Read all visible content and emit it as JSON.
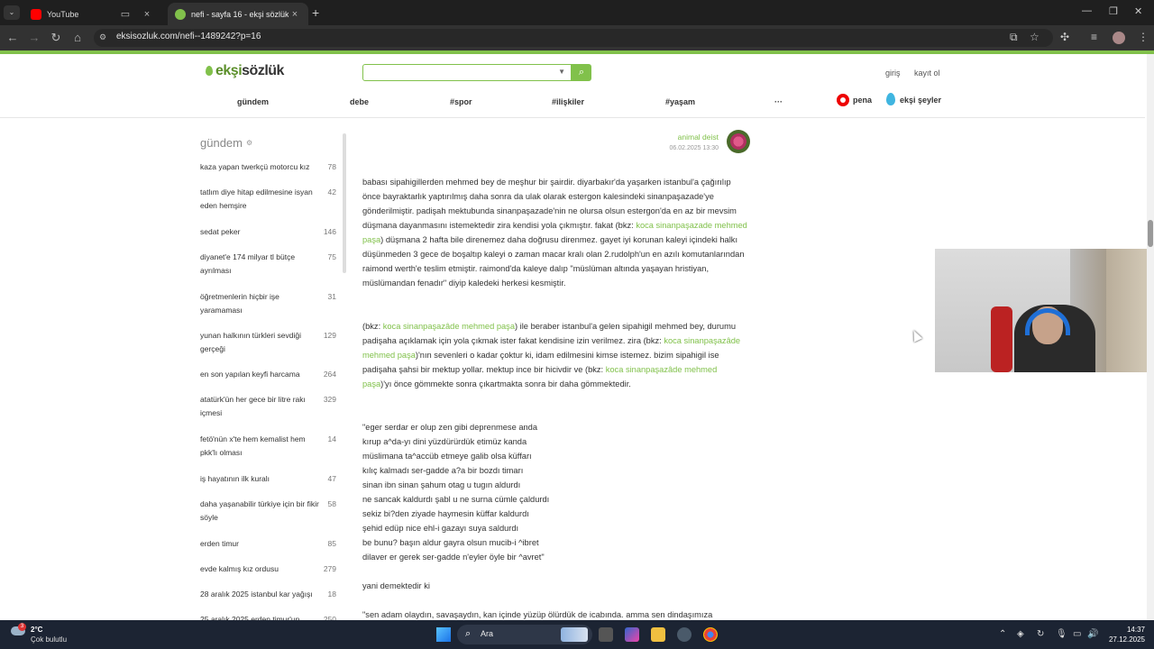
{
  "browser": {
    "tabs": [
      {
        "title": "YouTube",
        "favicon_color": "#ff0000"
      },
      {
        "title": "nefi - sayfa 16 - ekşi sözlük",
        "favicon_color": "#81c14b"
      }
    ],
    "url": "eksisozluk.com/nefi--1489242?p=16"
  },
  "site": {
    "logo_left": "ekşi",
    "logo_right": "sözlük",
    "search_placeholder": "",
    "login": "giriş",
    "register": "kayıt ol",
    "nav": [
      "gündem",
      "debe",
      "#spor",
      "#ilişkiler",
      "#yaşam",
      "···"
    ],
    "pena": "pena",
    "seyler": "ekşi şeyler",
    "accent_color": "#81c14b"
  },
  "sidebar": {
    "title": "gündem",
    "items": [
      {
        "title": "kaza yapan twerkçü motorcu kız",
        "count": "78"
      },
      {
        "title": "tatlım diye hitap edilmesine isyan eden hemşire",
        "count": "42"
      },
      {
        "title": "sedat peker",
        "count": "146"
      },
      {
        "title": "diyanet'e 174 milyar tl bütçe ayrılması",
        "count": "75"
      },
      {
        "title": "öğretmenlerin hiçbir işe yaramaması",
        "count": "31"
      },
      {
        "title": "yunan halkının türkleri sevdiği gerçeği",
        "count": "129"
      },
      {
        "title": "en son yapılan keyfi harcama",
        "count": "264"
      },
      {
        "title": "atatürk'ün her gece bir litre rakı içmesi",
        "count": "329"
      },
      {
        "title": "fetö'nün x'te hem kemalist hem pkk'lı olması",
        "count": "14"
      },
      {
        "title": "iş hayatının ilk kuralı",
        "count": "47"
      },
      {
        "title": "daha yaşanabilir türkiye için bir fikir söyle",
        "count": "58"
      },
      {
        "title": "erden timur",
        "count": "85"
      },
      {
        "title": "evde kalmış kız ordusu",
        "count": "279"
      },
      {
        "title": "28 aralık 2025 istanbul kar yağışı",
        "count": "18"
      },
      {
        "title": "25 aralık 2025 erden timur'un",
        "count": "250"
      }
    ]
  },
  "entry": {
    "author": "animal deist",
    "date": "06.02.2025 13:30",
    "p1_a": "babası sipahigillerden mehmed bey de meşhur bir şairdir. diyarbakır'da yaşarken istanbul'a çağırılıp önce bayraktarlık yaptırılmış daha sonra da ulak olarak estergon kalesindeki sinanpaşazade'ye gönderilmiştir. padişah mektubunda sinanpaşazade'nin ne olursa olsun estergon'da en az bir mevsim düşmana dayanmasını istemektedir zira kendisi yola çıkmıştır. fakat (bkz: ",
    "p1_link": "koca sinanpaşazade mehmed paşa",
    "p1_b": ") düşmana 2 hafta bile direnemez daha doğrusu direnmez. gayet iyi korunan kaleyi içindeki halkı düşünmeden 3 gece de boşaltıp kaleyi o zaman macar kralı olan 2.rudolph'un en azılı komutanlarından raimond werth'e teslim etmiştir. raimond'da kaleye dalıp \"müslüman altında yaşayan hristiyan, müslümandan fenadır\" diyip kaledeki herkesi kesmiştir.",
    "p2_a": "(bkz: ",
    "p2_link1": "koca sinanpaşazâde mehmed paşa",
    "p2_b": ") ile beraber istanbul'a gelen sipahigil mehmed bey, durumu padişaha açıklamak için yola çıkmak ister fakat kendisine izin verilmez. zira (bkz: ",
    "p2_link2": "koca sinanpaşazâde mehmed paşa",
    "p2_c": ")'nın sevenleri o kadar çoktur ki, idam edilmesini kimse istemez. bizim sipahigil ise padişaha şahsi bir mektup yollar. mektup ince bir hicivdir ve (bkz: ",
    "p2_link3": "koca sinanpaşazâde mehmed paşa",
    "p2_d": ")'yı önce gömmekte sonra çıkartmakta sonra bir daha gömmektedir.",
    "poem": [
      "\"eger serdar er olup zen gibi deprenmese anda",
      "kırup a^da-yı dini yüzdürürdük etimüz kanda",
      "müslimana ta^accüb etmeye galib olsa küffarı",
      "kılıç kalmadı ser-gadde a?a bir bozdı timarı",
      "sinan ibn sinan şahum otag u tugın aldurdı",
      "ne sancak kaldurdı şabl u ne surna cümle çaldurdı",
      "sekiz bi?den ziyade haymesin küffar kaldurdı",
      "şehid edüp nice ehl-i gazayı suya saldurdı",
      "be bunu? başın aldur gayra olsun mucib-i ^ibret",
      "dilaver er gerek ser-gadde n'eyler öyle bir ^avret\""
    ],
    "p3": "yani demektedir ki",
    "p4": "\"sen adam olaydın, savaşaydın, kan içinde yüzüp ölürdük de icabında. amma sen dindaşımıza"
  },
  "taskbar": {
    "temp": "2°C",
    "condition": "Çok bulutlu",
    "weather_badge": "3",
    "search": "Ara",
    "time": "14:37",
    "date": "27.12.2025"
  }
}
